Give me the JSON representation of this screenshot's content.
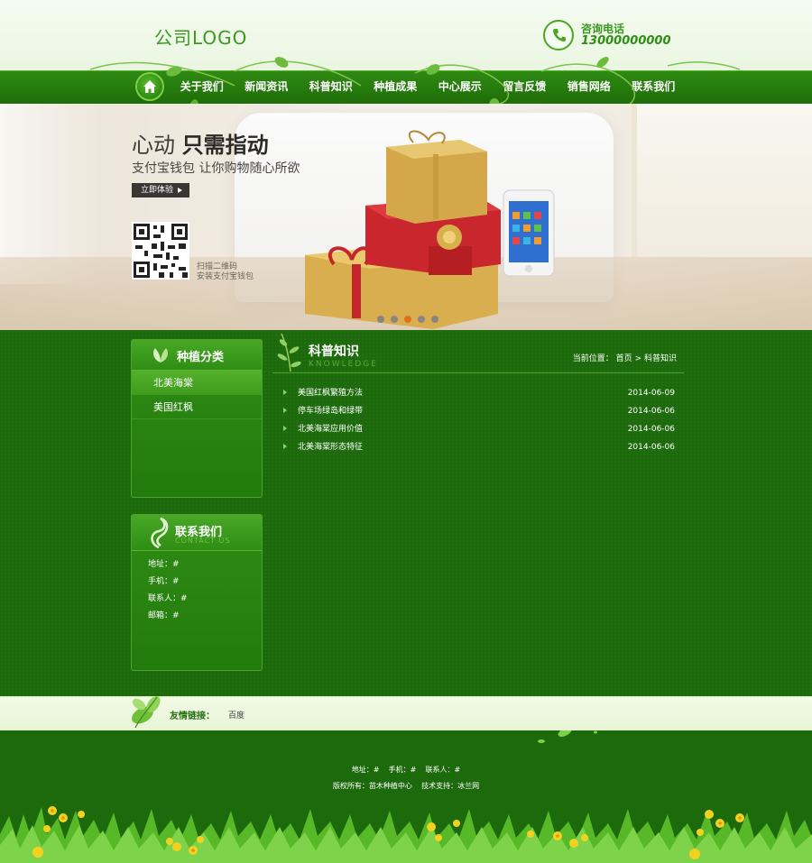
{
  "header": {
    "logo": "公司LOGO",
    "phone_label": "咨询电话",
    "phone_number": "13000000000"
  },
  "nav": {
    "items": [
      "关于我们",
      "新闻资讯",
      "科普知识",
      "种植成果",
      "中心展示",
      "留言反馈",
      "销售网络",
      "联系我们"
    ]
  },
  "banner": {
    "title_light": "心动",
    "title_bold": "只需指动",
    "subtitle": "支付宝钱包  让你购物随心所欲",
    "button": "立即体验",
    "qr_caption1": "扫描二维码",
    "qr_caption2": "安装支付宝钱包",
    "slides": 5,
    "active_slide": 3
  },
  "sidebar": {
    "categories": {
      "title": "种植分类",
      "items": [
        "北美海棠",
        "美国红枫"
      ]
    },
    "contact": {
      "title": "联系我们",
      "subtitle": "CONTACT US",
      "lines": [
        "地址：#",
        "手机：#",
        "联系人：#",
        "邮箱：#"
      ]
    }
  },
  "content": {
    "title": "科普知识",
    "subtitle": "KNOWLEDGE",
    "breadcrumb": {
      "prefix": "当前位置：",
      "home": "首页",
      "sep": ">",
      "current": "科普知识"
    },
    "articles": [
      {
        "title": "美国红枫繁殖方法",
        "date": "2014-06-09"
      },
      {
        "title": "停车场绿岛和绿带",
        "date": "2014-06-06"
      },
      {
        "title": "北美海棠应用价值",
        "date": "2014-06-06"
      },
      {
        "title": "北美海棠形态特征",
        "date": "2014-06-06"
      }
    ]
  },
  "links": {
    "label": "友情链接：",
    "items": [
      "百度"
    ]
  },
  "footer": {
    "line1": "地址：#    手机：#    联系人：#",
    "line2": "版权所有：苗木种植中心    技术支持：冰兰网"
  },
  "colors": {
    "brand_green": "#1d6a0c",
    "nav_green": "#2f8a12",
    "accent_orange": "#e2701a"
  }
}
